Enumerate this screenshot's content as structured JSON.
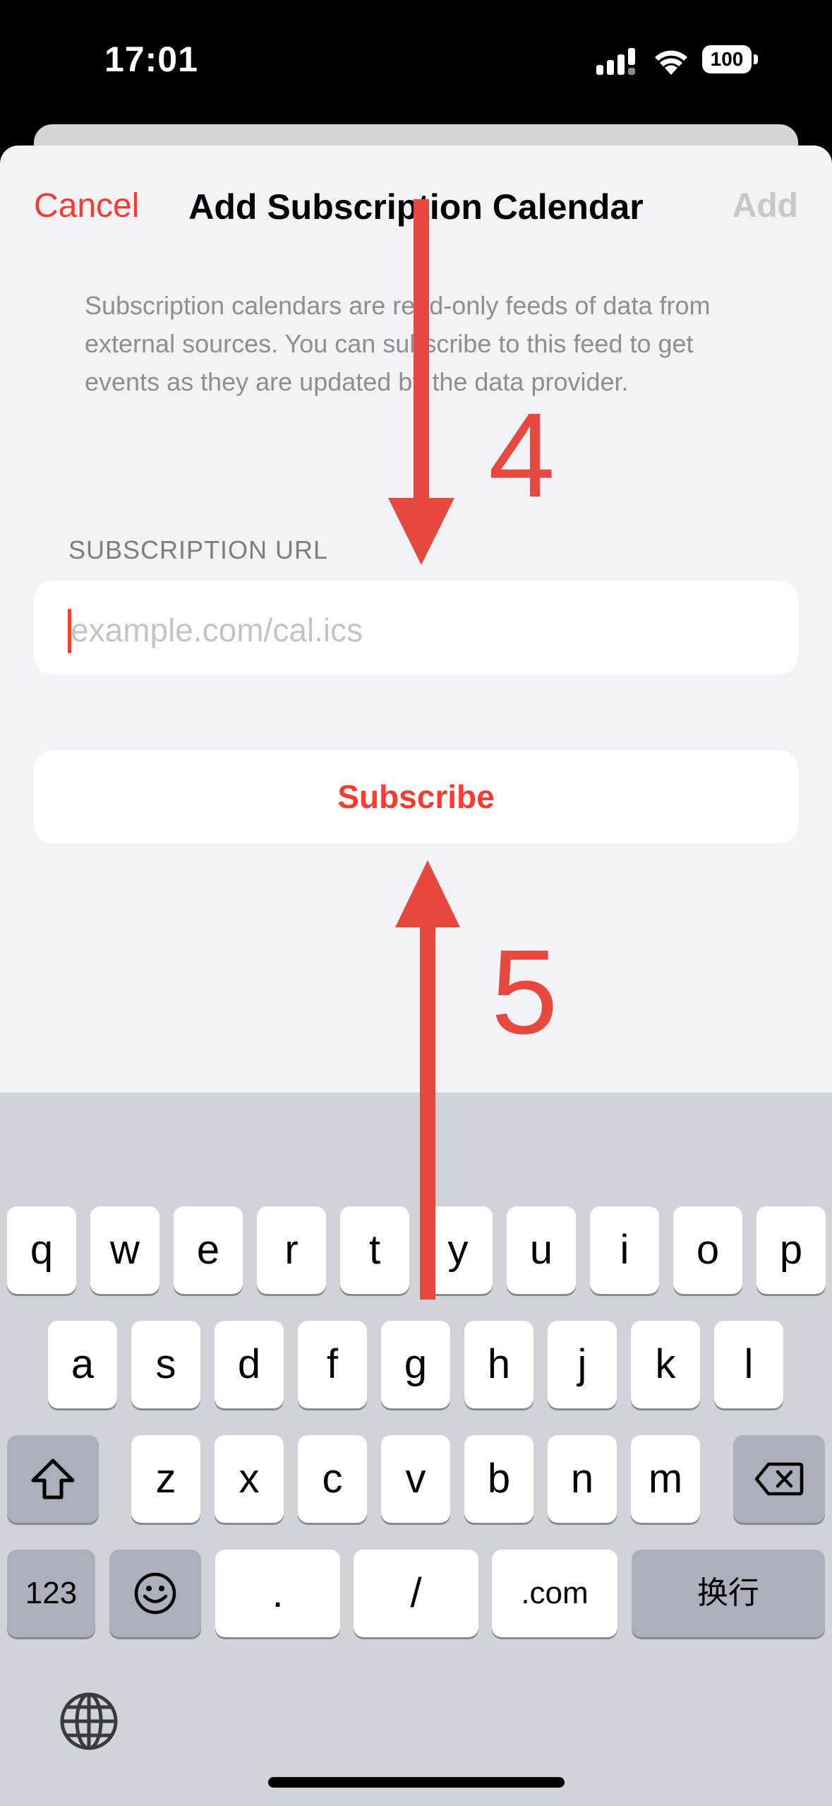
{
  "status": {
    "time": "17:01",
    "battery": "100"
  },
  "nav": {
    "cancel": "Cancel",
    "title": "Add Subscription Calendar",
    "add": "Add"
  },
  "description": "Subscription calendars are read-only feeds of data from external sources. You can subscribe to this feed to get events as they are updated by the data provider.",
  "url_section": {
    "header": "SUBSCRIPTION URL",
    "placeholder": "example.com/cal.ics",
    "value": ""
  },
  "subscribe_button": "Subscribe",
  "keyboard": {
    "row1": [
      "q",
      "w",
      "e",
      "r",
      "t",
      "y",
      "u",
      "i",
      "o",
      "p"
    ],
    "row2": [
      "a",
      "s",
      "d",
      "f",
      "g",
      "h",
      "j",
      "k",
      "l"
    ],
    "row3": [
      "z",
      "x",
      "c",
      "v",
      "b",
      "n",
      "m"
    ],
    "numbers_key": "123",
    "period_key": ".",
    "slash_key": "/",
    "dotcom_key": ".com",
    "return_key": "换行"
  },
  "annotations": {
    "step_a": "4",
    "step_b": "5",
    "color": "#e8493f"
  },
  "colors": {
    "accent": "#ff3b30",
    "background": "#f2f2f7",
    "keyboard": "#d1d3d9"
  }
}
